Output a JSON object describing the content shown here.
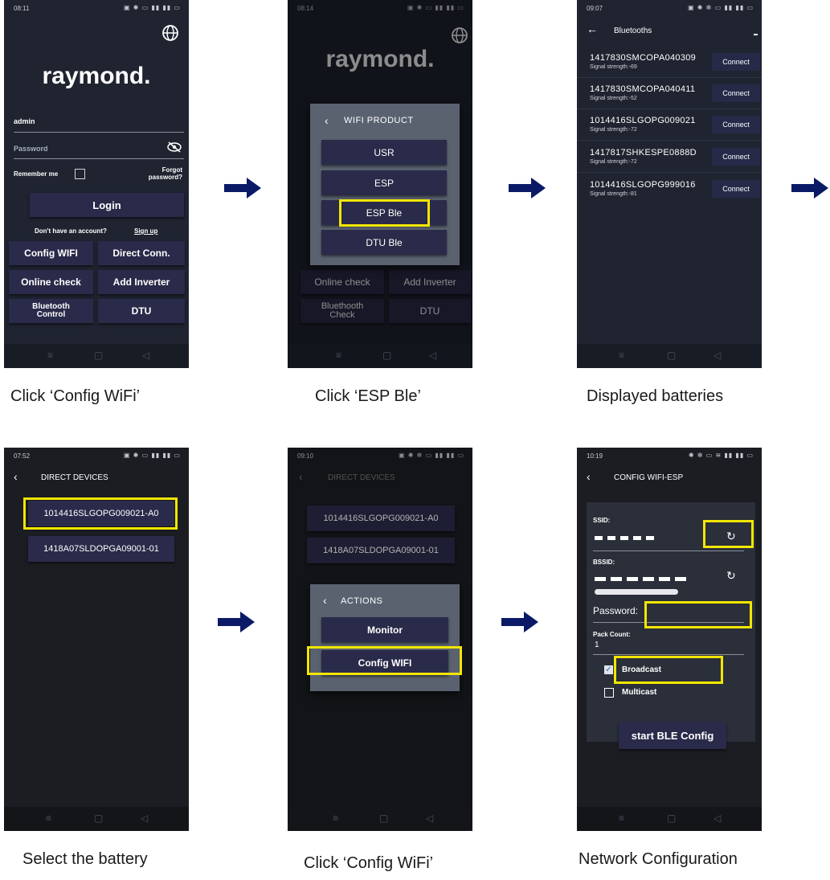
{
  "screens": [
    {
      "status_time": "08:11",
      "logo": "raymond.",
      "username_value": "admin",
      "password_placeholder": "Password",
      "remember_label": "Remember me",
      "forgot_label": "Forgot password?",
      "login_label": "Login",
      "no_account_text": "Don't have an account?",
      "signup_label": "Sign up",
      "grid": [
        "Config WIFI",
        "Direct Conn.",
        "Online check",
        "Add Inverter",
        "Bluetooth Control",
        "DTU"
      ],
      "caption": "Click ‘Config WiFi’"
    },
    {
      "status_time": "08:14",
      "logo": "raymond.",
      "dialog_title": "WIFI PRODUCT",
      "options": [
        "USR",
        "ESP",
        "ESP Ble",
        "DTU Ble"
      ],
      "grid": [
        "Online check",
        "Add Inverter",
        "Bluethooth Check",
        "DTU"
      ],
      "caption": "Click ‘ESP Ble’"
    },
    {
      "status_time": "09:07",
      "title": "Bluetooths",
      "devices": [
        {
          "id": "1417830SMCOPA040309",
          "signal": "Signal strength:-69"
        },
        {
          "id": "1417830SMCOPA040411",
          "signal": "Signal strength:-52"
        },
        {
          "id": "1014416SLGOPG009021",
          "signal": "Signal strength:-72"
        },
        {
          "id": "1417817SHKESPE0888D",
          "signal": "Signal strength:-72"
        },
        {
          "id": "1014416SLGOPG999016",
          "signal": "Signal strength:-81"
        }
      ],
      "connect_label": "Connect",
      "caption": "Displayed batteries"
    },
    {
      "status_time": "07:52",
      "title": "DIRECT DEVICES",
      "devices": [
        "1014416SLGOPG009021-A0",
        "1418A07SLDOPGA09001-01"
      ],
      "caption": "Select the battery"
    },
    {
      "status_time": "09:10",
      "title": "DIRECT DEVICES",
      "devices": [
        "1014416SLGOPG009021-A0",
        "1418A07SLDOPGA09001-01"
      ],
      "dialog_title": "ACTIONS",
      "actions": [
        "Monitor",
        "Config WIFI"
      ],
      "caption": "Click ‘Config WiFi’"
    },
    {
      "status_time": "10:19",
      "title": "CONFIG WIFI-ESP",
      "ssid_label": "SSID:",
      "bssid_label": "BSSID:",
      "password_label": "Password:",
      "pack_count_label": "Pack Count:",
      "pack_count_value": "1",
      "broadcast_label": "Broadcast",
      "multicast_label": "Multicast",
      "start_label": "start BLE Config",
      "caption": "Network Configuration"
    }
  ],
  "colors": {
    "highlight": "#f2e600",
    "arrow": "#0b1a66",
    "screen_bg": "#1f2430",
    "button": "#2a2a4a"
  }
}
